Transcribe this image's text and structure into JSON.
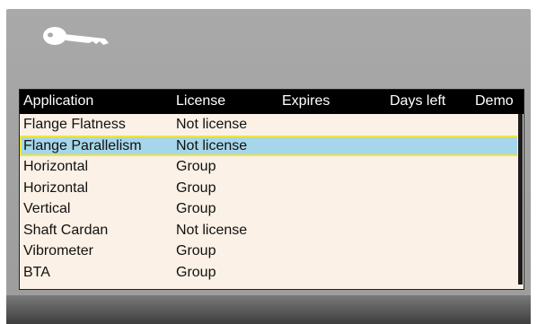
{
  "header": {
    "columns": [
      "Application",
      "License",
      "Expires",
      "Days left",
      "Demo"
    ]
  },
  "rows": [
    {
      "application": "Flange Flatness",
      "license": "Not license",
      "expires": "",
      "days_left": "",
      "demo": ""
    },
    {
      "application": "Flange Parallelism",
      "license": "Not license",
      "expires": "",
      "days_left": "",
      "demo": "",
      "selected": true
    },
    {
      "application": "Horizontal",
      "license": "Group",
      "expires": "",
      "days_left": "",
      "demo": ""
    },
    {
      "application": "Horizontal",
      "license": "Group",
      "expires": "",
      "days_left": "",
      "demo": ""
    },
    {
      "application": "Vertical",
      "license": "Group",
      "expires": "",
      "days_left": "",
      "demo": ""
    },
    {
      "application": "Shaft Cardan",
      "license": "Not license",
      "expires": "",
      "days_left": "",
      "demo": ""
    },
    {
      "application": "Vibrometer",
      "license": "Group",
      "expires": "",
      "days_left": "",
      "demo": ""
    },
    {
      "application": "BTA",
      "license": "Group",
      "expires": "",
      "days_left": "",
      "demo": ""
    }
  ],
  "icons": {
    "header_icon": "key-icon"
  },
  "colors": {
    "selected_row": "#a6d6ea",
    "selected_outline": "#f0e63a",
    "panel_bg": "#fbf1e6",
    "header_bg": "#000000"
  }
}
